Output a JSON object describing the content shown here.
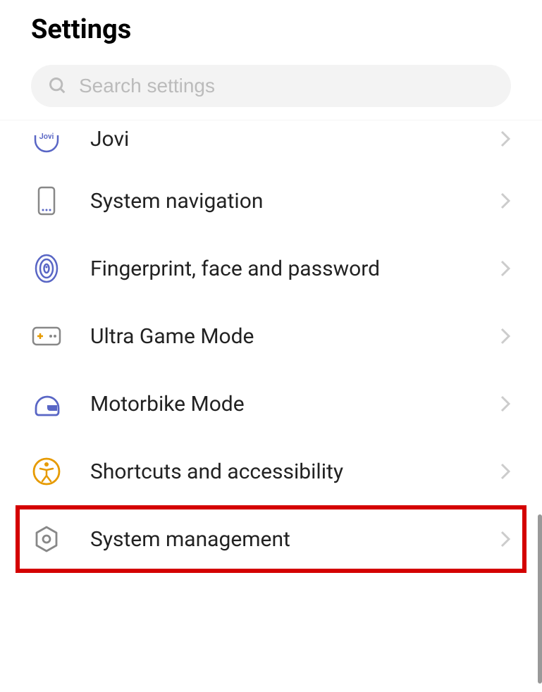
{
  "header": {
    "title": "Settings"
  },
  "search": {
    "placeholder": "Search settings"
  },
  "items": [
    {
      "id": "jovi",
      "label": "Jovi",
      "icon": "jovi-icon"
    },
    {
      "id": "system-navigation",
      "label": "System navigation",
      "icon": "phone-icon"
    },
    {
      "id": "fingerprint",
      "label": "Fingerprint, face and password",
      "icon": "fingerprint-icon"
    },
    {
      "id": "ultra-game-mode",
      "label": "Ultra Game Mode",
      "icon": "gamepad-icon"
    },
    {
      "id": "motorbike-mode",
      "label": "Motorbike Mode",
      "icon": "helmet-icon"
    },
    {
      "id": "shortcuts",
      "label": "Shortcuts and accessibility",
      "icon": "accessibility-icon"
    },
    {
      "id": "system-management",
      "label": "System management",
      "icon": "gear-icon",
      "highlighted": true
    }
  ]
}
